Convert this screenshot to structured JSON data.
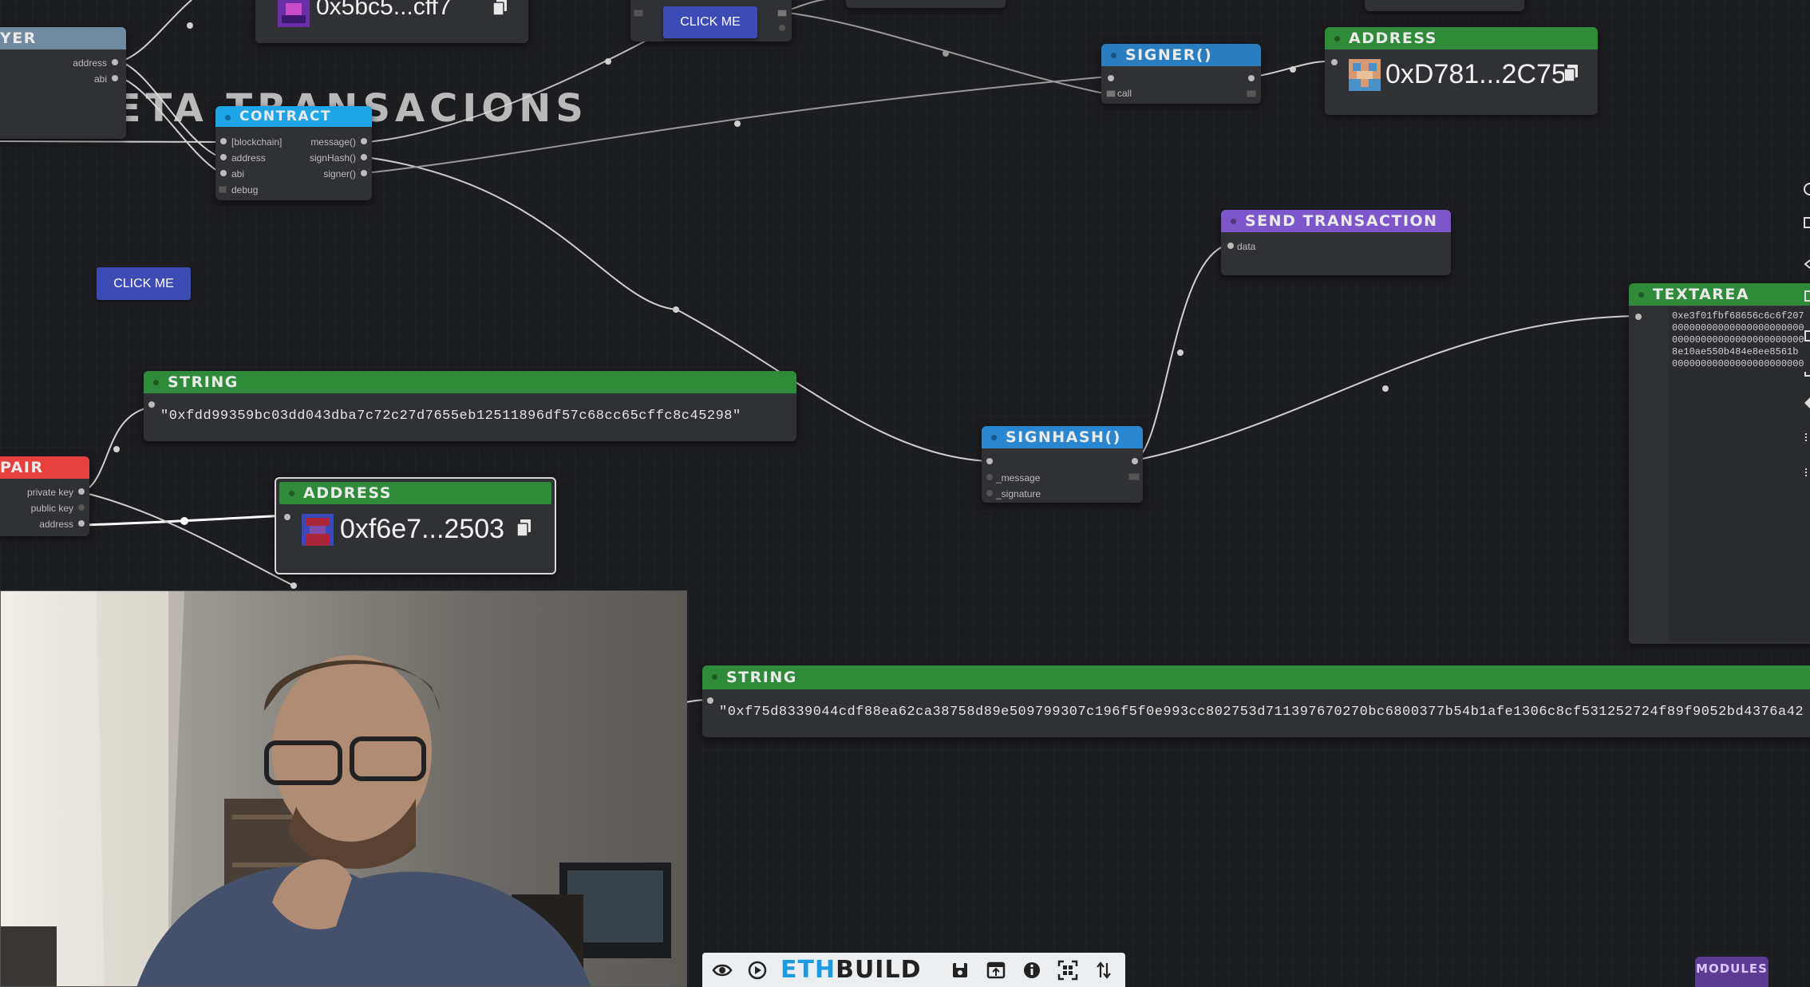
{
  "heading": "META TRANSACIONS",
  "buttons": {
    "click_me_top": "CLICK ME",
    "click_me_left": "CLICK ME"
  },
  "top_partial": {
    "address": "0x5bc5...cff7"
  },
  "layer_node": {
    "title": "YER",
    "slots": [
      "address",
      "abi"
    ]
  },
  "contract_node": {
    "title": "CONTRACT",
    "inputs": [
      "[blockchain]",
      "address",
      "abi",
      "debug"
    ],
    "outputs": [
      "message()",
      "signHash()",
      "signer()"
    ]
  },
  "signer_node": {
    "title": "SIGNER()",
    "slots": [
      "call"
    ]
  },
  "address_top": {
    "title": "ADDRESS",
    "value": "0xD781...2C75"
  },
  "send_tx_node": {
    "title": "SEND TRANSACTION",
    "slots": [
      "data"
    ]
  },
  "textarea_node": {
    "title": "TEXTAREA",
    "lines": [
      "0xe3f01fbf68656c6c6f207",
      "00000000000000000000000",
      "00000000000000000000000",
      "8e10ae550b484e8ee8561b",
      "00000000000000000000000"
    ]
  },
  "string_node_1": {
    "title": "STRING",
    "value": "\"0xfdd99359bc03dd043dba7c72c27d7655eb12511896df57c68cc65cffc8c45298\""
  },
  "keypair_node": {
    "title": "PAIR",
    "slots": [
      "private key",
      "public key",
      "address"
    ]
  },
  "address_bottom": {
    "title": "ADDRESS",
    "value": "0xf6e7...2503"
  },
  "signhash_node": {
    "title": "SIGNHASH()",
    "slots": [
      "_message",
      "_signature"
    ]
  },
  "string_node_2": {
    "title": "STRING",
    "value": "\"0xf75d8339044cdf88ea62ca38758d89e509799307c196f5f0e993cc802753d711397670270bc6800377b54b1afe1306c8cf531252724f89f9052bd4376a42"
  },
  "toolbar": {
    "brand_left": "ETH",
    "brand_right": "BUILD",
    "modules": "MODULES"
  }
}
